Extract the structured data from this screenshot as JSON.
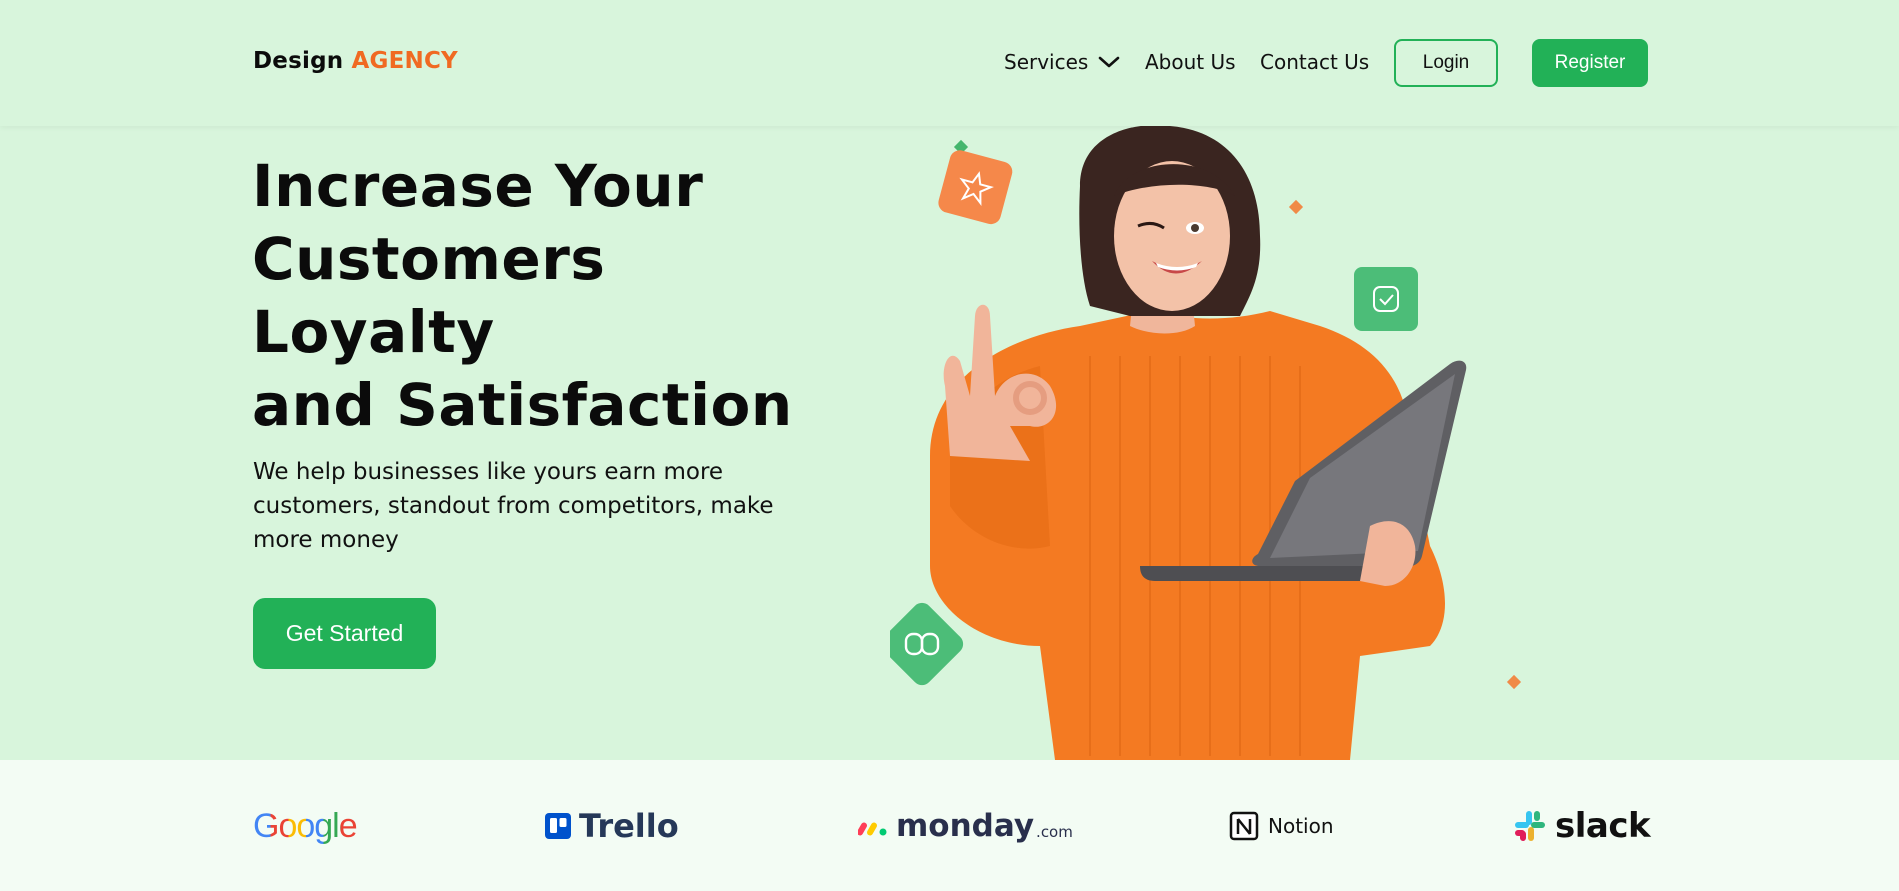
{
  "header": {
    "logo_main": "Design",
    "logo_accent": "AGENCY",
    "nav": {
      "services": "Services",
      "about": "About Us",
      "contact": "Contact Us"
    },
    "login_label": "Login",
    "register_label": "Register"
  },
  "hero": {
    "title_lines": [
      "Increase Your",
      "Customers",
      "Loyalty",
      "and Satisfaction"
    ],
    "subtitle": "We help businesses like yours earn more customers, standout from competitors, make more money",
    "cta_label": "Get Started"
  },
  "brands": {
    "google": "Google",
    "trello": "Trello",
    "monday": "monday",
    "monday_tld": ".com",
    "notion": "Notion",
    "slack": "slack"
  },
  "colors": {
    "background": "#d8f5dc",
    "accent_green": "#22b157",
    "accent_orange": "#f06a22",
    "logos_bar": "#f3fcf4"
  },
  "icons": {
    "services_dropdown": "chevron-down-icon",
    "floating_badges": [
      "star-icon",
      "check-badge-icon",
      "link-icon"
    ]
  }
}
